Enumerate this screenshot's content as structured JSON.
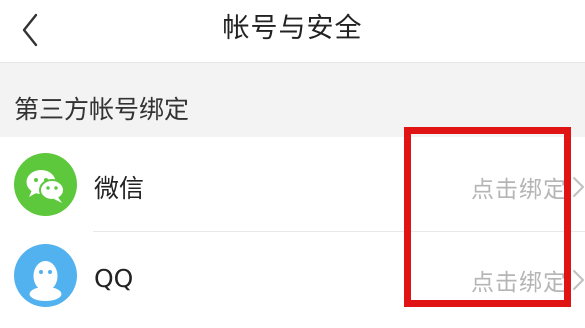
{
  "header": {
    "title": "帐号与安全",
    "back_icon": "chevron-left-icon"
  },
  "section": {
    "title": "第三方帐号绑定"
  },
  "accounts": [
    {
      "label": "微信",
      "action": "点击绑定",
      "icon": "wechat-icon",
      "color": "#5dc83b"
    },
    {
      "label": "QQ",
      "action": "点击绑定",
      "icon": "qq-icon",
      "color": "#52b2ef"
    }
  ],
  "colors": {
    "highlight": "#e01414",
    "muted_text": "#b5b5b5",
    "section_bg": "#f3f3f3"
  }
}
